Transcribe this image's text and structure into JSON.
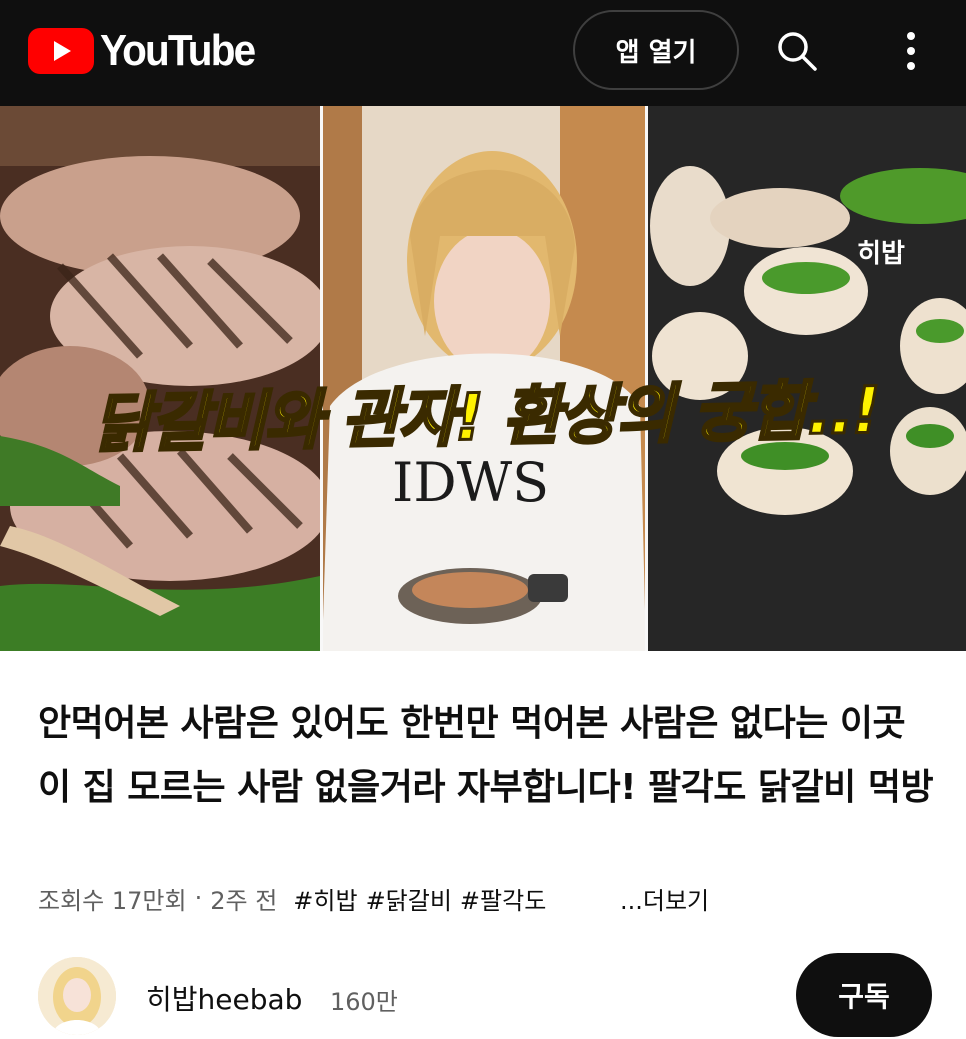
{
  "header": {
    "logo_text": "YouTube",
    "open_app_label": "앱 열기",
    "search_icon": "search-icon",
    "more_icon": "more-vertical-icon"
  },
  "thumbnail": {
    "caption": "닭갈비와 관자! 환상의 궁합..!",
    "channel_badge": "히밥",
    "shirt_text": "IDWS"
  },
  "video": {
    "title": "안먹어본 사람은 있어도 한번만 먹어본 사람은 없다는 이곳 이 집 모르는 사람 없을거라 자부합니다! 팔각도 닭갈비 먹방",
    "views": "조회수 17만회",
    "age": "2주 전",
    "hashtags": [
      "#히밥",
      "#닭갈비",
      "#팔각도"
    ],
    "more_label": "...더보기"
  },
  "channel": {
    "name": "히밥heebab",
    "subscribers": "160만",
    "subscribe_label": "구독"
  },
  "colors": {
    "topbar_bg": "#0f0f0f",
    "brand_red": "#ff0000",
    "caption_yellow": "#fff200"
  }
}
